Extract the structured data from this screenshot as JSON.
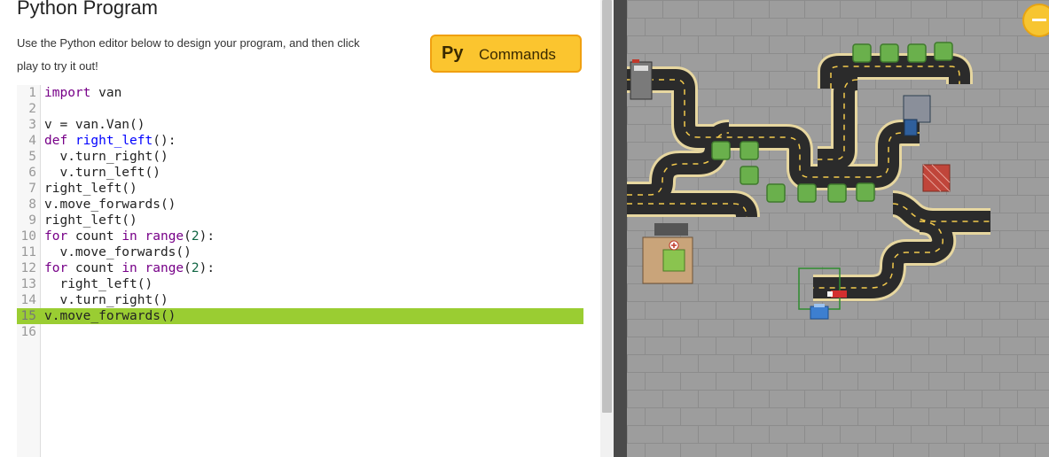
{
  "header": {
    "title": "Python Program",
    "description": "Use the Python editor below to design your program, and then click play to try it out!"
  },
  "commands_button": {
    "icon_text": "Py",
    "label": "Commands"
  },
  "editor": {
    "lines": [
      {
        "num": "1",
        "code": "import van"
      },
      {
        "num": "2",
        "code": ""
      },
      {
        "num": "3",
        "code": "v = van.Van()"
      },
      {
        "num": "4",
        "code": "def right_left():"
      },
      {
        "num": "5",
        "code": "  v.turn_right()"
      },
      {
        "num": "6",
        "code": "  v.turn_left()"
      },
      {
        "num": "7",
        "code": "right_left()"
      },
      {
        "num": "8",
        "code": "v.move_forwards()"
      },
      {
        "num": "9",
        "code": "right_left()"
      },
      {
        "num": "10",
        "code": "for count in range(2):"
      },
      {
        "num": "11",
        "code": "  v.move_forwards()"
      },
      {
        "num": "12",
        "code": "for count in range(2):"
      },
      {
        "num": "13",
        "code": "  right_left()"
      },
      {
        "num": "14",
        "code": "  v.turn_right()"
      },
      {
        "num": "15",
        "code": "v.move_forwards()"
      },
      {
        "num": "16",
        "code": ""
      }
    ],
    "highlighted_line": "15"
  },
  "game": {
    "road_color": "#2b2b2b",
    "road_edge_color": "#e7d7a0",
    "grass_color": "#6ab04c",
    "background_color": "#9d9d9d"
  },
  "icons": {
    "zoom": "minus-icon"
  }
}
